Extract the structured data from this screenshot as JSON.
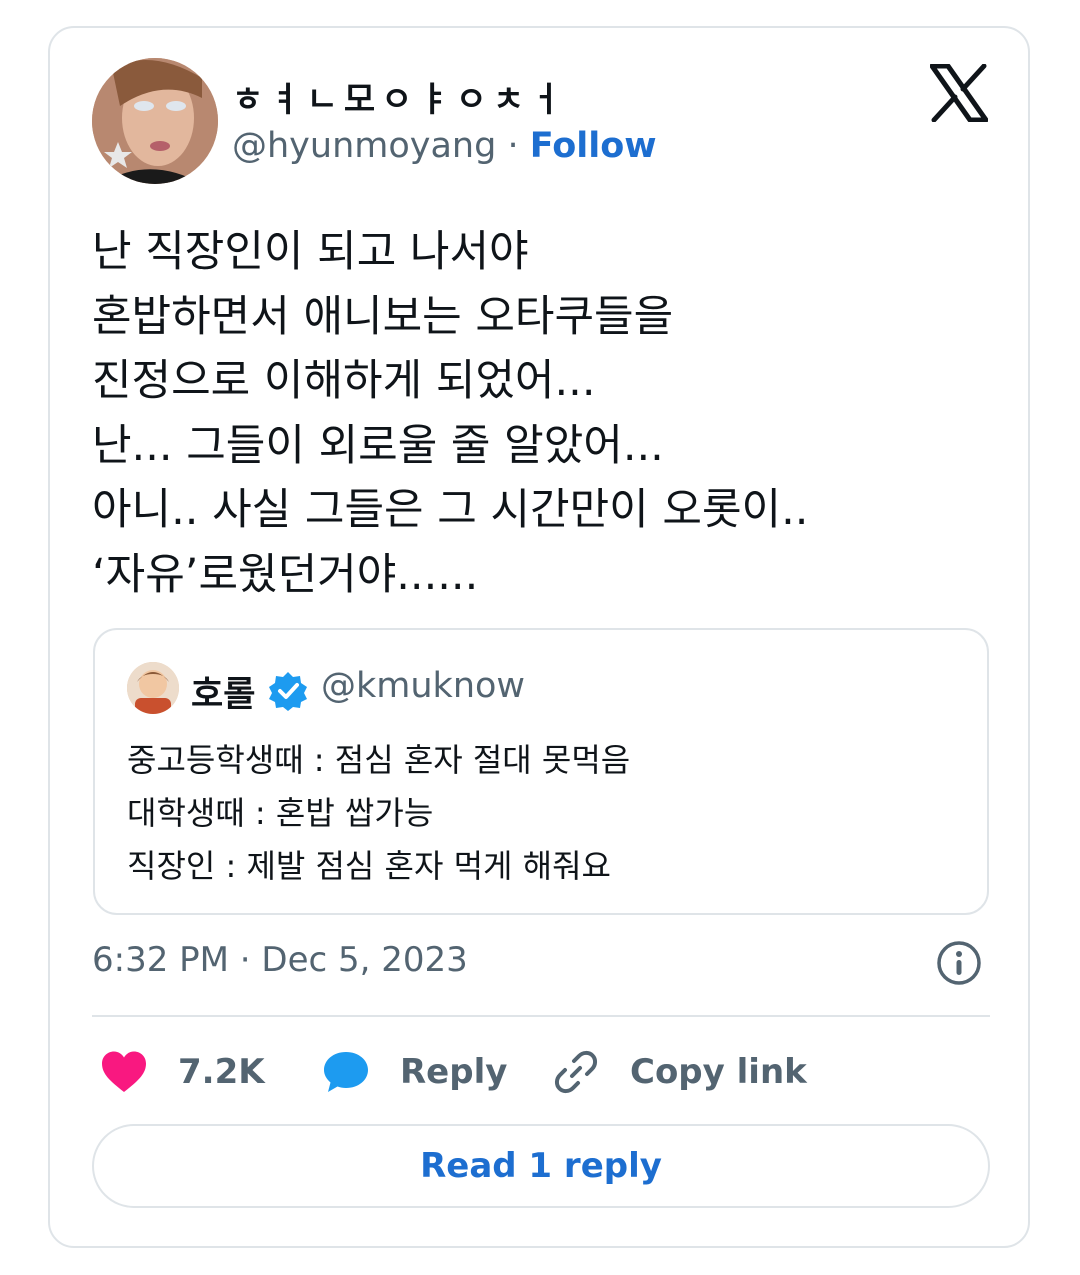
{
  "tweet": {
    "display_name": "ㅎㅕㄴ모ㅇㅑㅇㅊㅓ",
    "handle": "@hyunmoyang",
    "separator": " · ",
    "follow_label": "Follow",
    "text": "난 직장인이 되고 나서야\n혼밥하면서 애니보는 오타쿠들을\n진정으로 이해하게 되었어...\n난... 그들이 외로울 줄 알았어...\n아니.. 사실 그들은 그 시간만이 오롯이..\n‘자유’로웠던거야......",
    "timestamp": "6:32 PM · Dec 5, 2023"
  },
  "quote": {
    "name": "호롤",
    "handle": "@kmuknow",
    "verified": true,
    "text": "중고등학생때 : 점심 혼자 절대 못먹음\n대학생때 : 혼밥 쌉가능\n직장인 : 제발 점심 혼자 먹게 해줘요"
  },
  "actions": {
    "like_count": "7.2K",
    "reply_label": "Reply",
    "copy_label": "Copy link"
  },
  "read_replies_label": "Read 1 reply",
  "colors": {
    "accent": "#1d6ed0",
    "like": "#f91880",
    "reply_icon": "#1d9bf0",
    "verified": "#1d9bf0",
    "muted_text": "#536471",
    "border": "#dfe4e8"
  },
  "icons": [
    "x-logo-icon",
    "verified-badge-icon",
    "info-icon",
    "heart-icon",
    "reply-bubble-icon",
    "link-icon"
  ]
}
